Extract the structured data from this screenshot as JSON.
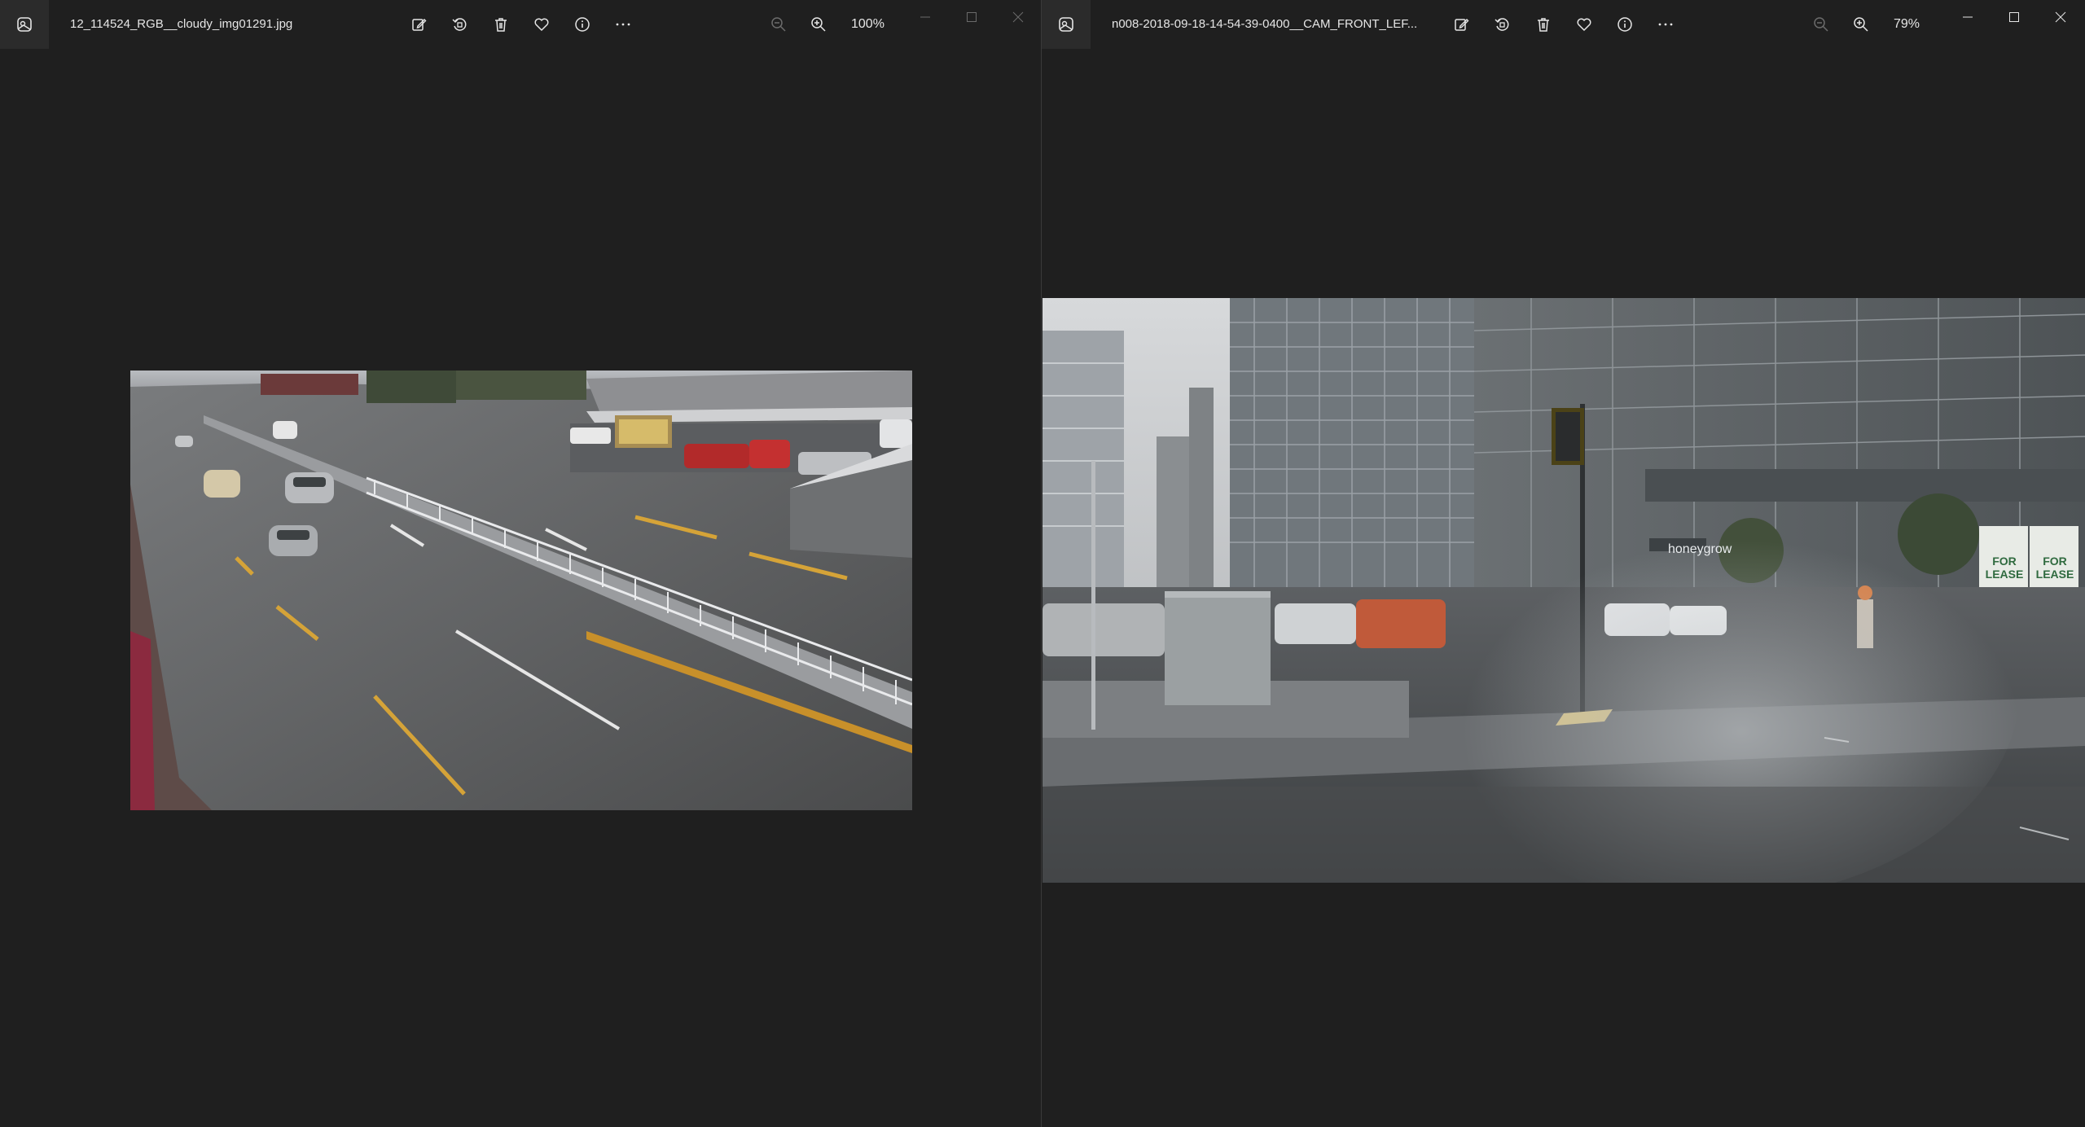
{
  "left_window": {
    "filename": "12_114524_RGB__cloudy_img01291.jpg",
    "zoom": "100%"
  },
  "right_window": {
    "filename": "n008-2018-09-18-14-54-39-0400__CAM_FRONT_LEF...",
    "zoom": "79%",
    "sign_text": "honeygrow",
    "lease_text_1": "FOR LEASE",
    "lease_text_2": "FOR LEASE"
  },
  "colors": {
    "background": "#1f1f1f",
    "titlebar_icon_bg": "#2b2b2b",
    "text": "#e6e6e6",
    "dim_icon": "#6b6b6b"
  },
  "icons": [
    "photos-app-icon",
    "edit-icon",
    "rotate-icon",
    "delete-icon",
    "favorite-icon",
    "info-icon",
    "more-icon",
    "zoom-out-icon",
    "zoom-in-icon",
    "minimize-icon",
    "maximize-icon",
    "close-icon"
  ]
}
